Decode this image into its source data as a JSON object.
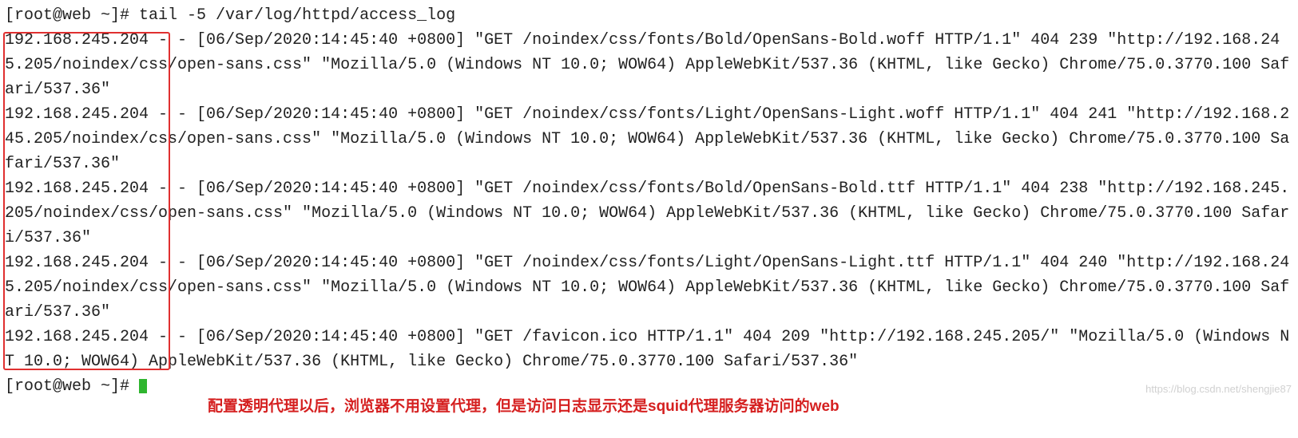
{
  "prompt": "[root@web ~]# ",
  "command": "tail -5 /var/log/httpd/access_log",
  "highlight_ip": "192.168.245.204",
  "log_lines": [
    "192.168.245.204 - - [06/Sep/2020:14:45:40 +0800] \"GET /noindex/css/fonts/Bold/OpenSans-Bold.woff HTTP/1.1\" 404 239 \"http://192.168.245.205/noindex/css/open-sans.css\" \"Mozilla/5.0 (Windows NT 10.0; WOW64) AppleWebKit/537.36 (KHTML, like Gecko) Chrome/75.0.3770.100 Safari/537.36\"",
    "192.168.245.204 - - [06/Sep/2020:14:45:40 +0800] \"GET /noindex/css/fonts/Light/OpenSans-Light.woff HTTP/1.1\" 404 241 \"http://192.168.245.205/noindex/css/open-sans.css\" \"Mozilla/5.0 (Windows NT 10.0; WOW64) AppleWebKit/537.36 (KHTML, like Gecko) Chrome/75.0.3770.100 Safari/537.36\"",
    "192.168.245.204 - - [06/Sep/2020:14:45:40 +0800] \"GET /noindex/css/fonts/Bold/OpenSans-Bold.ttf HTTP/1.1\" 404 238 \"http://192.168.245.205/noindex/css/open-sans.css\" \"Mozilla/5.0 (Windows NT 10.0; WOW64) AppleWebKit/537.36 (KHTML, like Gecko) Chrome/75.0.3770.100 Safari/537.36\"",
    "192.168.245.204 - - [06/Sep/2020:14:45:40 +0800] \"GET /noindex/css/fonts/Light/OpenSans-Light.ttf HTTP/1.1\" 404 240 \"http://192.168.245.205/noindex/css/open-sans.css\" \"Mozilla/5.0 (Windows NT 10.0; WOW64) AppleWebKit/537.36 (KHTML, like Gecko) Chrome/75.0.3770.100 Safari/537.36\"",
    "192.168.245.204 - - [06/Sep/2020:14:45:40 +0800] \"GET /favicon.ico HTTP/1.1\" 404 209 \"http://192.168.245.205/\" \"Mozilla/5.0 (Windows NT 10.0; WOW64) AppleWebKit/537.36 (KHTML, like Gecko) Chrome/75.0.3770.100 Safari/537.36\""
  ],
  "prompt2_prefix": "[root@web ~]# ",
  "annotation": "配置透明代理以后，浏览器不用设置代理，但是访问日志显示还是squid代理服务器访问的web",
  "watermark": "https://blog.csdn.net/shengjie87"
}
